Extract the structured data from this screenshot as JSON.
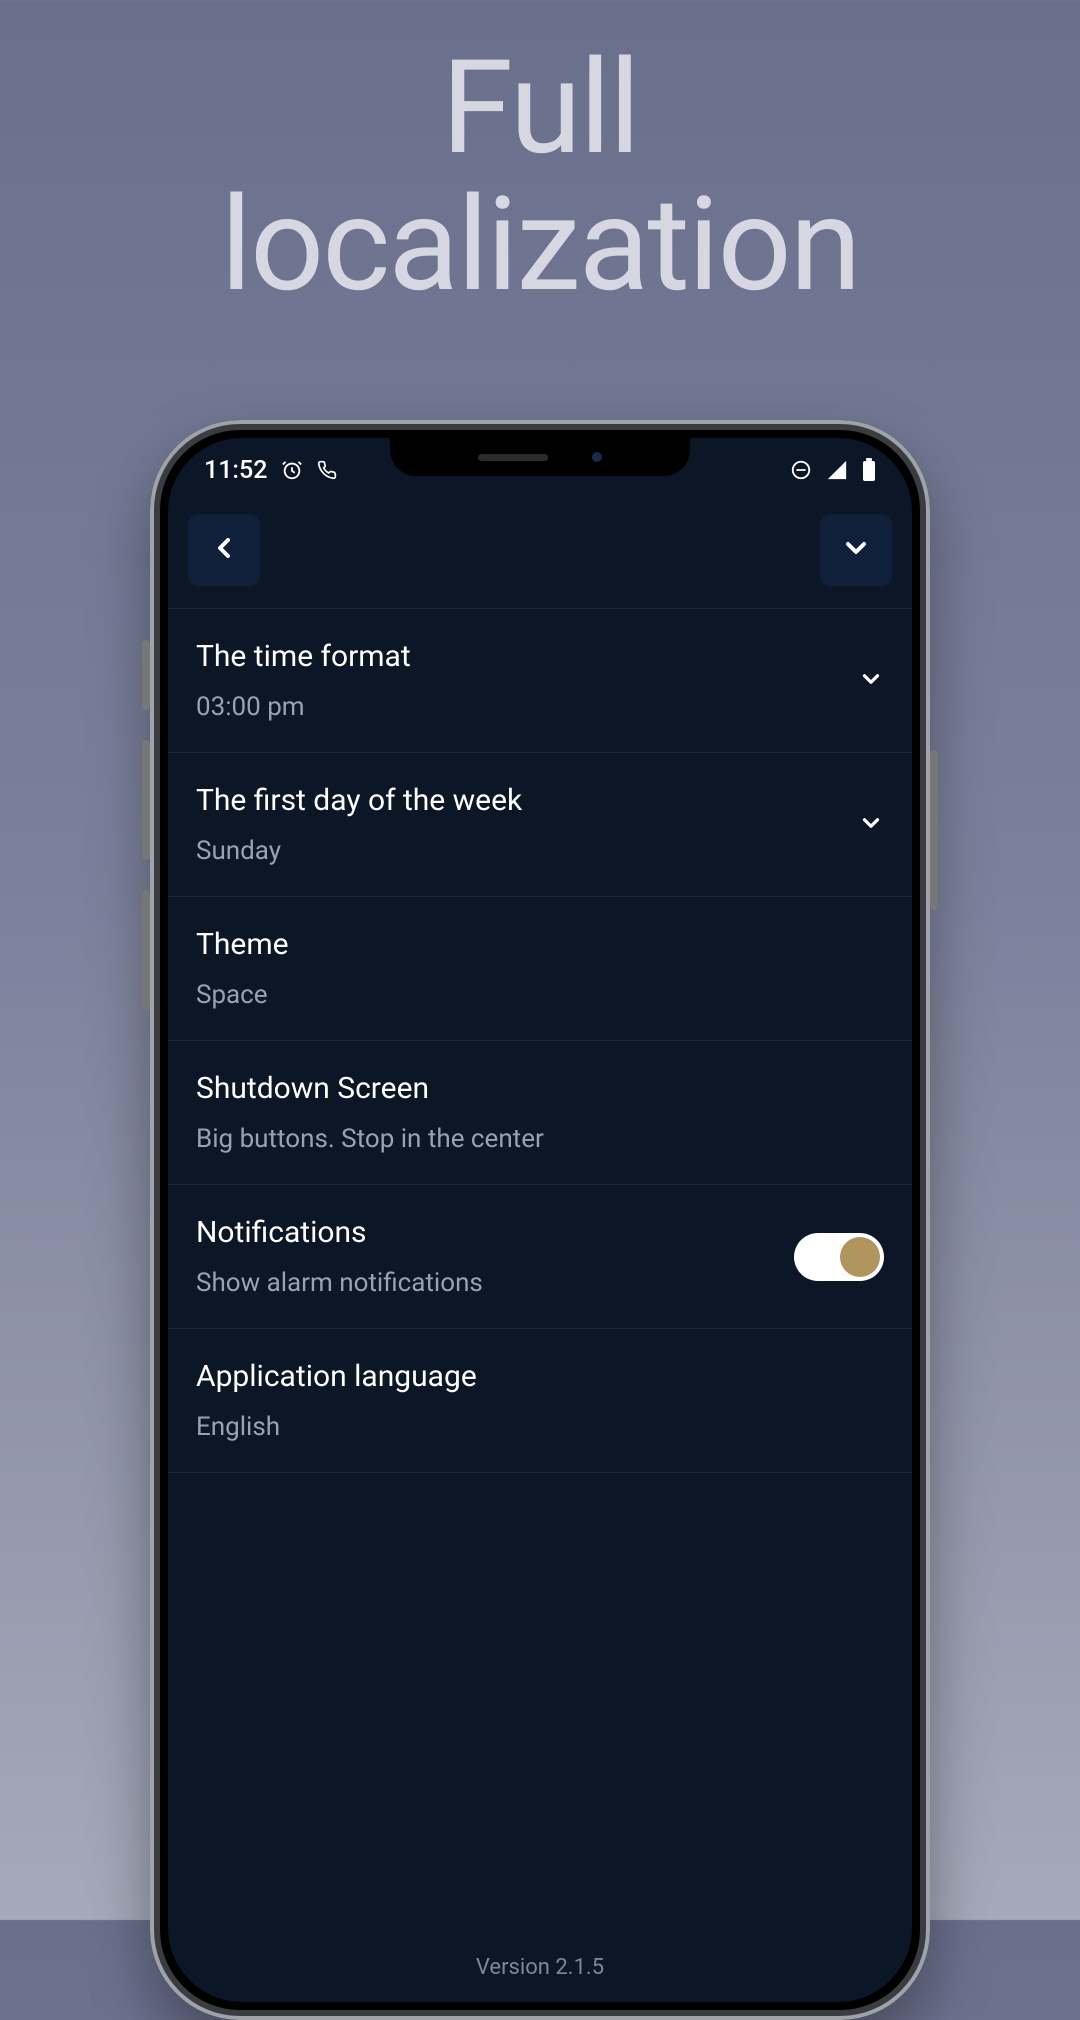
{
  "headline_line1": "Full",
  "headline_line2": "localization",
  "statusbar": {
    "time": "11:52"
  },
  "settings": {
    "time_format": {
      "title": "The time format",
      "value": "03:00 pm",
      "has_dropdown": true
    },
    "first_day": {
      "title": "The first day of the week",
      "value": "Sunday",
      "has_dropdown": true
    },
    "theme": {
      "title": "Theme",
      "value": "Space",
      "has_dropdown": false
    },
    "shutdown": {
      "title": "Shutdown Screen",
      "value": "Big buttons. Stop in the center",
      "has_dropdown": false
    },
    "notifications": {
      "title": "Notifications",
      "value": "Show alarm notifications",
      "toggle_on": true
    },
    "language": {
      "title": "Application language",
      "value": "English",
      "has_dropdown": false
    }
  },
  "footer": {
    "version": "Version 2.1.5"
  }
}
